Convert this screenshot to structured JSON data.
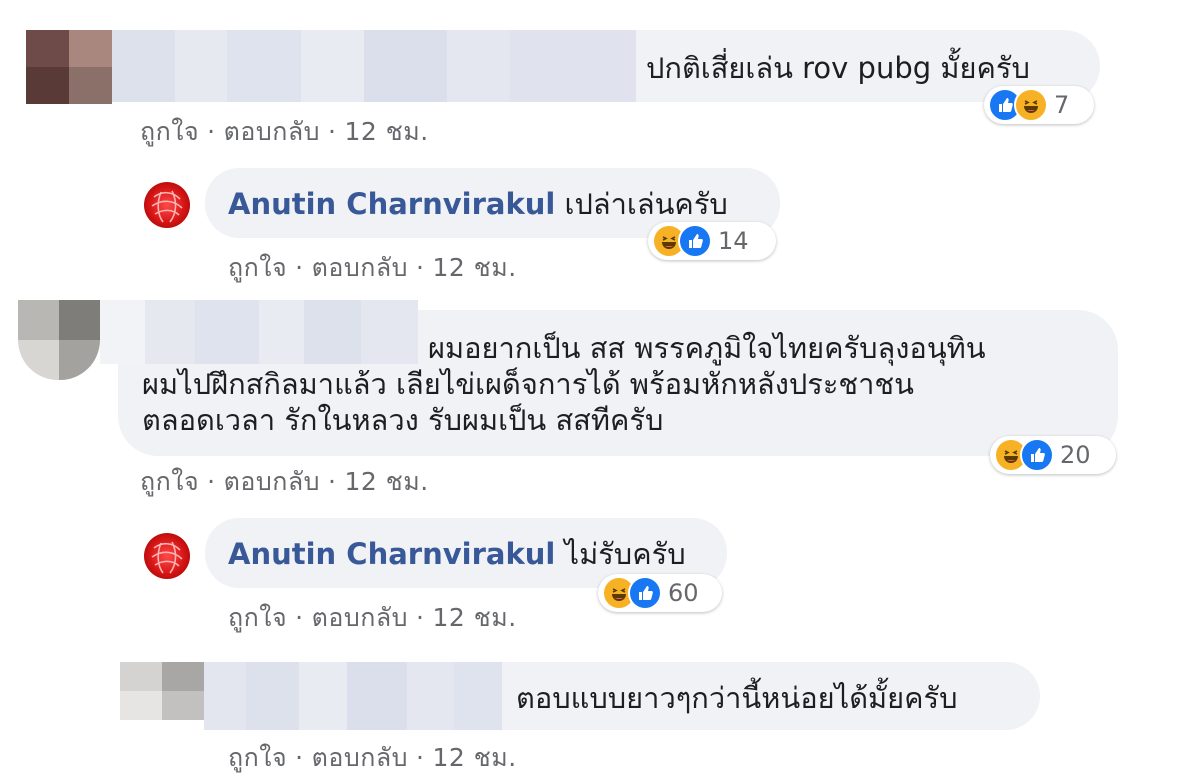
{
  "comments": [
    {
      "text": "ปกติเสี่ยเล่น rov pubg มั้ยครับ",
      "actions": {
        "like": "ถูกใจ",
        "reply": "ตอบกลับ",
        "time": "12 ชม."
      },
      "reactions": {
        "icons": [
          "like-icon",
          "haha-icon"
        ],
        "count": "7"
      },
      "avatar_colors": [
        "#6e4a48",
        "#a9877f",
        "#5a3a36",
        "#8a7069"
      ]
    },
    {
      "author": "Anutin Charnvirakul",
      "text": "เปล่าเล่นครับ",
      "actions": {
        "like": "ถูกใจ",
        "reply": "ตอบกลับ",
        "time": "12 ชม."
      },
      "reactions": {
        "icons": [
          "haha-icon",
          "like-icon"
        ],
        "count": "14"
      }
    },
    {
      "text_lines": [
        "ผมอยากเป็น สส พรรคภูมิใจไทยครับลุงอนุทิน",
        "ผมไปฝึกสกิลมาแล้ว เลียไข่เผด็จการได้ พร้อมหักหลังประชาชน",
        "ตลอดเวลา รักในหลวง รับผมเป็น สสทีครับ"
      ],
      "actions": {
        "like": "ถูกใจ",
        "reply": "ตอบกลับ",
        "time": "12 ชม."
      },
      "reactions": {
        "icons": [
          "haha-icon",
          "like-icon"
        ],
        "count": "20"
      },
      "avatar_colors": [
        "#b9b7b4",
        "#7f7d7a",
        "#d7d6d3",
        "#a4a29f"
      ]
    },
    {
      "author": "Anutin Charnvirakul",
      "text": "ไม่รับครับ",
      "actions": {
        "like": "ถูกใจ",
        "reply": "ตอบกลับ",
        "time": "12 ชม."
      },
      "reactions": {
        "icons": [
          "haha-icon",
          "like-icon"
        ],
        "count": "60"
      }
    },
    {
      "text": "ตอบแบบยาวๆกว่านี้หน่อยได้มั้ยครับ",
      "actions": {
        "like": "ถูกใจ",
        "reply": "ตอบกลับ",
        "time": "12 ชม."
      },
      "avatar_colors": [
        "#d4d3d1",
        "#a8a7a5",
        "#e6e5e3",
        "#c2c1bf"
      ]
    }
  ],
  "colors": {
    "like": "#1877f2",
    "haha": "#f7b125",
    "author": "#385898",
    "bubble": "#f0f2f5",
    "meta": "#65676b"
  }
}
